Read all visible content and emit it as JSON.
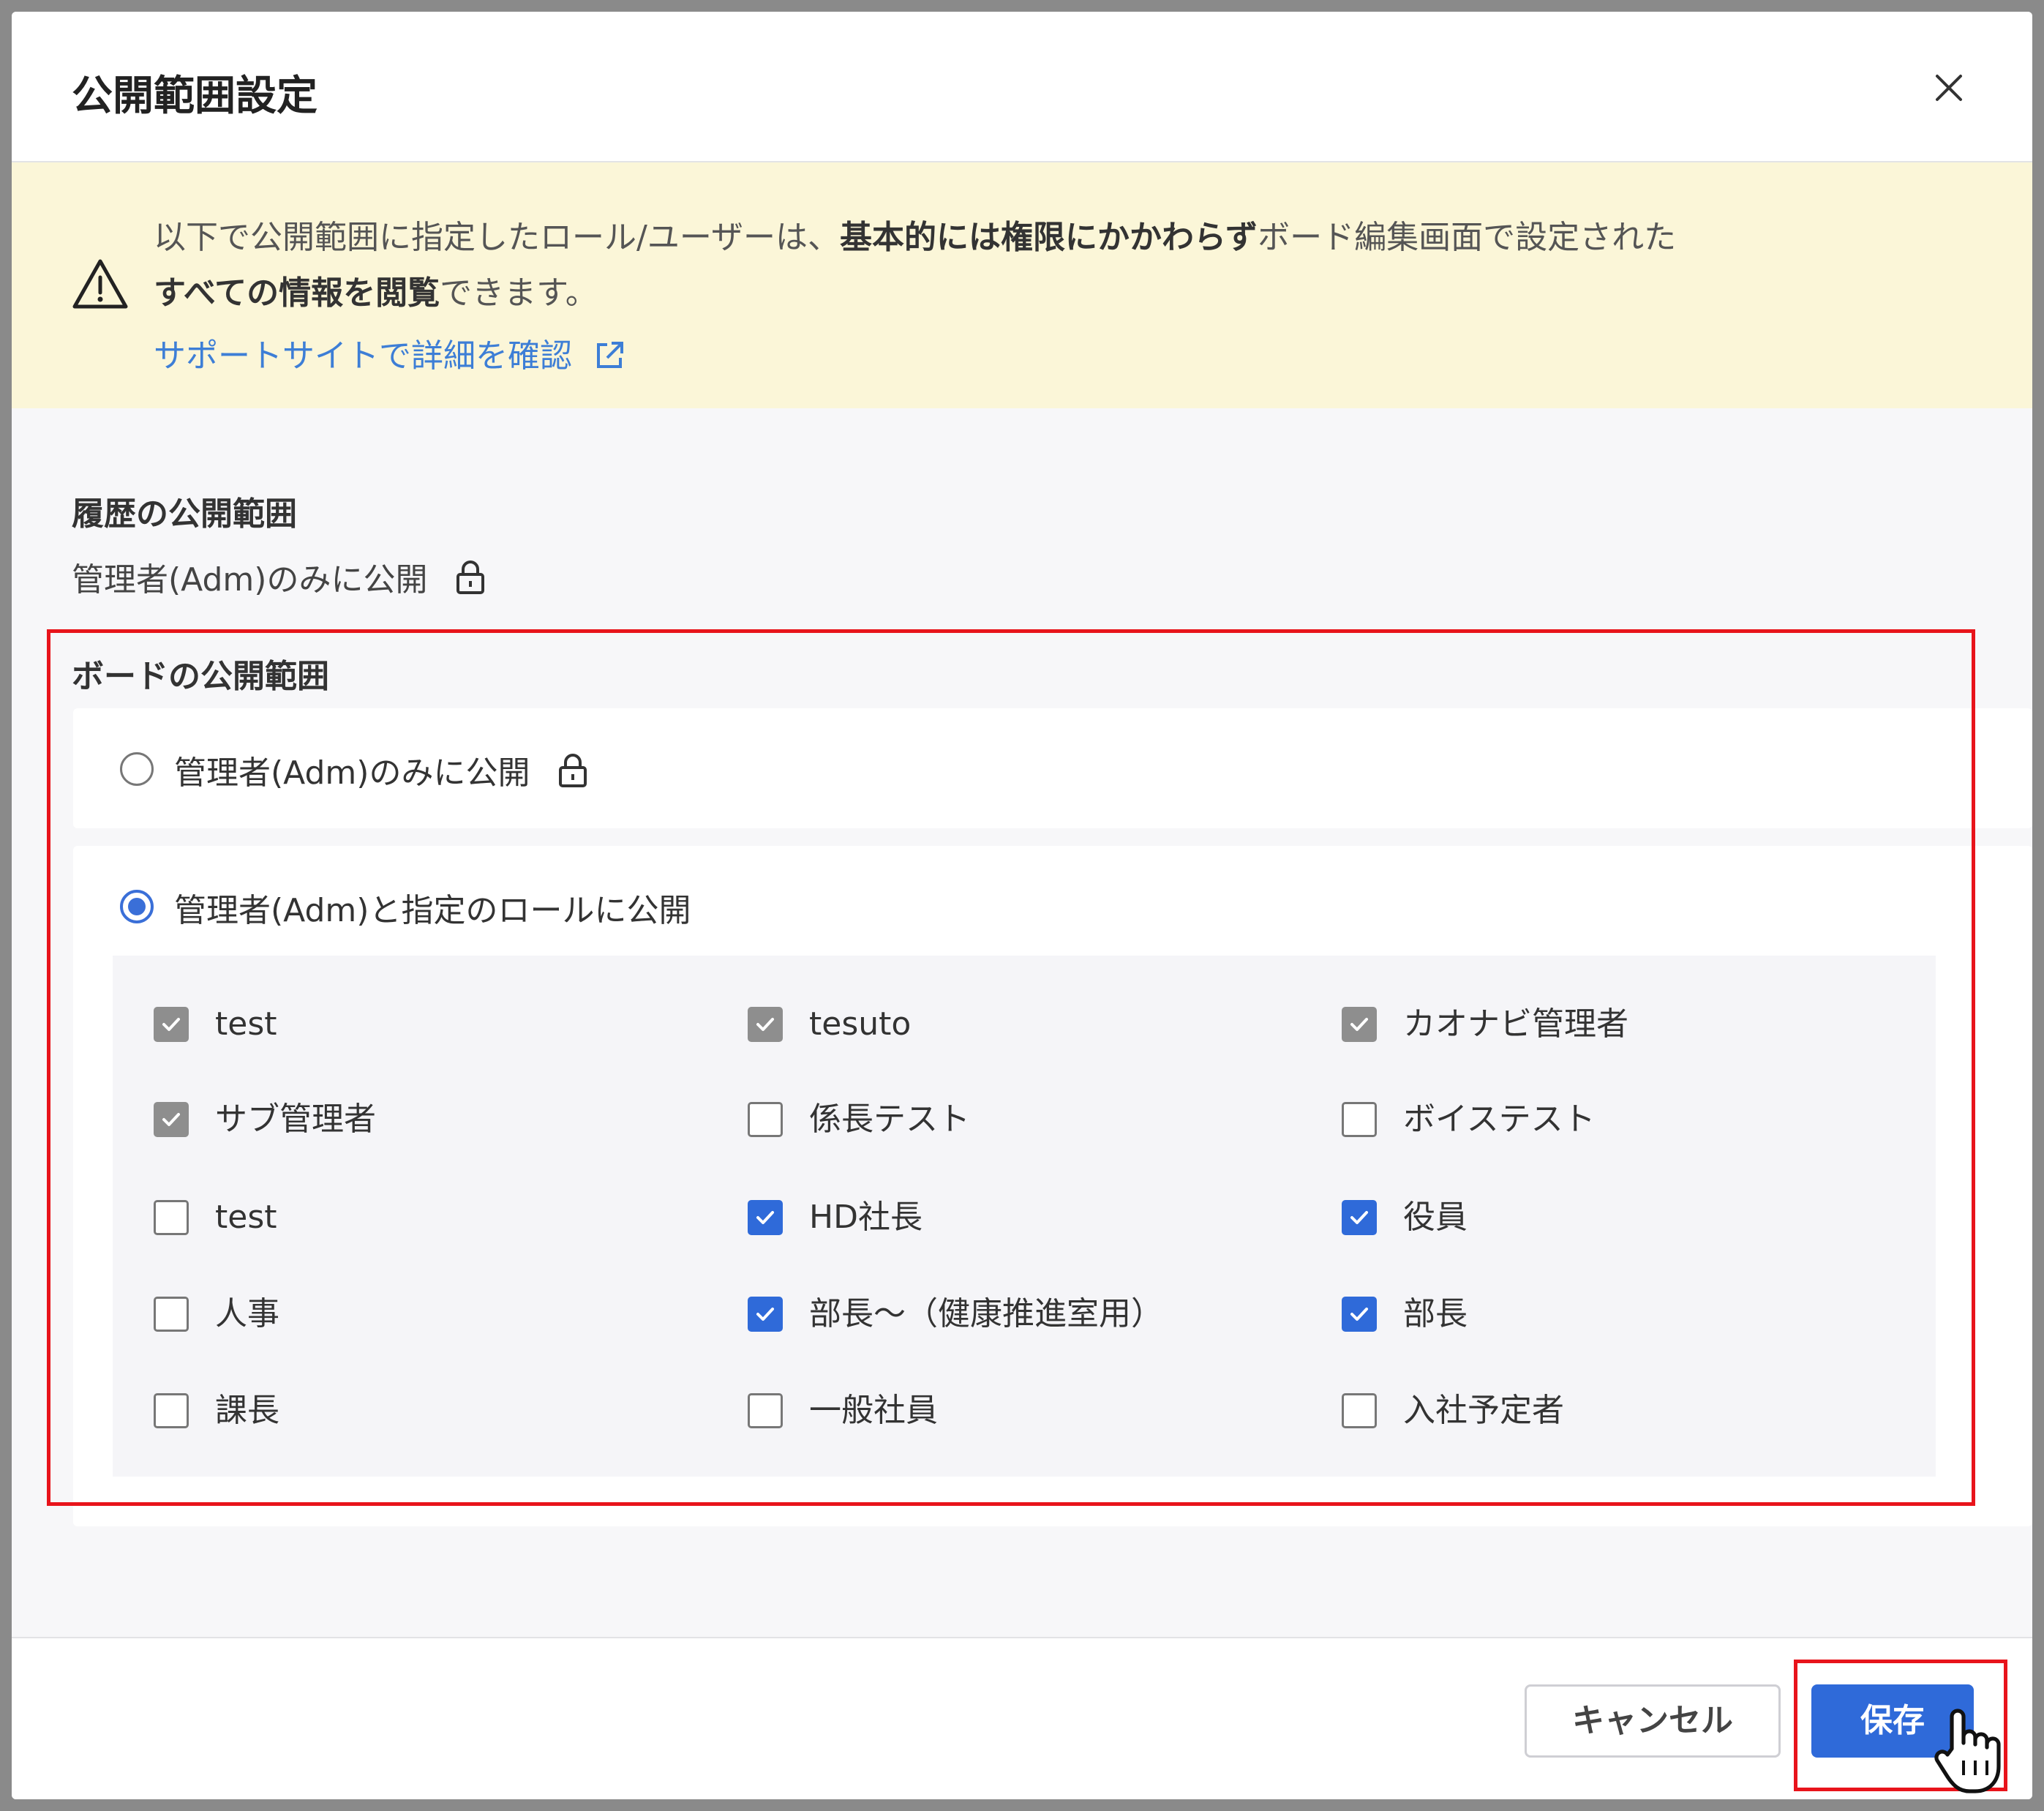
{
  "dialog": {
    "title": "公開範囲設定"
  },
  "notice": {
    "line1_pre": "以下で公開範囲に指定したロール/ユーザーは、",
    "line1_bold": "基本的には権限にかかわらず",
    "line1_post": "ボード編集画面で設定された",
    "line2_bold": "すべての情報を閲覧",
    "line2_post": "できます。",
    "link": "サポートサイトで詳細を確認",
    "bg_color": "#fbf6d8",
    "link_color": "#3d7ed6"
  },
  "history": {
    "label": "履歴の公開範囲",
    "value": "管理者(Adm)のみに公開"
  },
  "board": {
    "label": "ボードの公開範囲",
    "option_admin_only": "管理者(Adm)のみに公開",
    "option_admin_roles": "管理者(Adm)と指定のロールに公開",
    "selected": "admin_roles",
    "roles": [
      {
        "label": "test",
        "state": "checked-disabled"
      },
      {
        "label": "tesuto",
        "state": "checked-disabled"
      },
      {
        "label": "カオナビ管理者",
        "state": "checked-disabled"
      },
      {
        "label": "サブ管理者",
        "state": "checked-disabled"
      },
      {
        "label": "係長テスト",
        "state": "unchecked"
      },
      {
        "label": "ボイステスト",
        "state": "unchecked"
      },
      {
        "label": "test",
        "state": "unchecked"
      },
      {
        "label": "HD社長",
        "state": "checked"
      },
      {
        "label": "役員",
        "state": "checked"
      },
      {
        "label": "人事",
        "state": "unchecked"
      },
      {
        "label": "部長～（健康推進室用）",
        "state": "checked"
      },
      {
        "label": "部長",
        "state": "checked"
      },
      {
        "label": "課長",
        "state": "unchecked"
      },
      {
        "label": "一般社員",
        "state": "unchecked"
      },
      {
        "label": "入社予定者",
        "state": "unchecked"
      }
    ]
  },
  "footer": {
    "cancel_label": "キャンセル",
    "save_label": "保存",
    "primary_color": "#2f6ad9",
    "highlight_color": "#e8141b"
  }
}
